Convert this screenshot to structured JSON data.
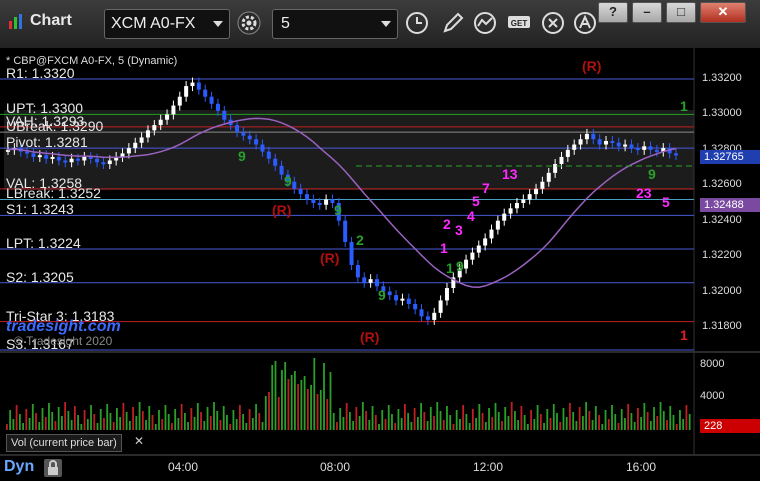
{
  "app": {
    "title": "Chart",
    "symbol": "XCM A0-FX",
    "interval": "5"
  },
  "window_buttons": [
    "?",
    "–",
    "□",
    "✕"
  ],
  "chart": {
    "subtitle": "* CBP@FXCM A0-FX, 5 (Dynamic)",
    "brand": "tradesight.com",
    "brand_copy": "© Tradesight 2020",
    "levels": [
      {
        "label": "R1: 1.3320",
        "price": 1.332,
        "color": "#4a5ad8"
      },
      {
        "label": "UPT: 1.3300",
        "price": 1.33,
        "color": "#22a022"
      },
      {
        "label": "VAH: 1.3293",
        "price": 1.3293,
        "color": "#c02020"
      },
      {
        "label": "UBreak: 1.3290",
        "price": 1.329,
        "color": "#8a8a8a"
      },
      {
        "label": "Pivot: 1.3281",
        "price": 1.3281,
        "color": "#4a5ad8"
      },
      {
        "label": "VAL: 1.3258",
        "price": 1.3258,
        "color": "#c02020"
      },
      {
        "label": "LBreak: 1.3252",
        "price": 1.3252,
        "color": "#4aa0c0"
      },
      {
        "label": "S1: 1.3243",
        "price": 1.3243,
        "color": "#4a5ad8"
      },
      {
        "label": "LPT: 1.3224",
        "price": 1.3224,
        "color": "#4a5ad8"
      },
      {
        "label": "S2: 1.3205",
        "price": 1.3205,
        "color": "#4a5ad8"
      },
      {
        "label": "Tri-Star 3: 1.3183",
        "price": 1.3183,
        "color": "#c02020"
      },
      {
        "label": "S3: 1.3167",
        "price": 1.3167,
        "color": "#4a5ad8"
      }
    ],
    "price_axis": [
      "1.33200",
      "1.33000",
      "1.32800",
      "1.32600",
      "1.32400",
      "1.32200",
      "1.32000",
      "1.31800"
    ],
    "current_price": "1.32765",
    "ma_price": "1.32488",
    "r_marks": [
      "(R)",
      "(R)",
      "(R)",
      "(R)"
    ],
    "counts_magenta": [
      "1",
      "2",
      "3",
      "4",
      "5",
      "7",
      "13",
      "23",
      "5"
    ],
    "counts_green": [
      "9",
      "9",
      "9",
      "9",
      "9",
      "9",
      "2",
      "1"
    ],
    "right_markers": [
      "1",
      "1"
    ]
  },
  "volume": {
    "label": "Vol (current price bar)",
    "close": "✕",
    "axis": [
      "8000",
      "4000"
    ],
    "current": "228"
  },
  "time_axis": [
    "04:00",
    "08:00",
    "12:00",
    "16:00"
  ],
  "footer": {
    "dyn": "Dyn"
  },
  "colors": {
    "background": "#000000",
    "bull": "#ffffff",
    "bear": "#2a5cff",
    "ma": "#9a62c0",
    "accent": "#ff2aff",
    "current_badge": "#1f3fb0",
    "vol_badge": "#cc0000"
  }
}
